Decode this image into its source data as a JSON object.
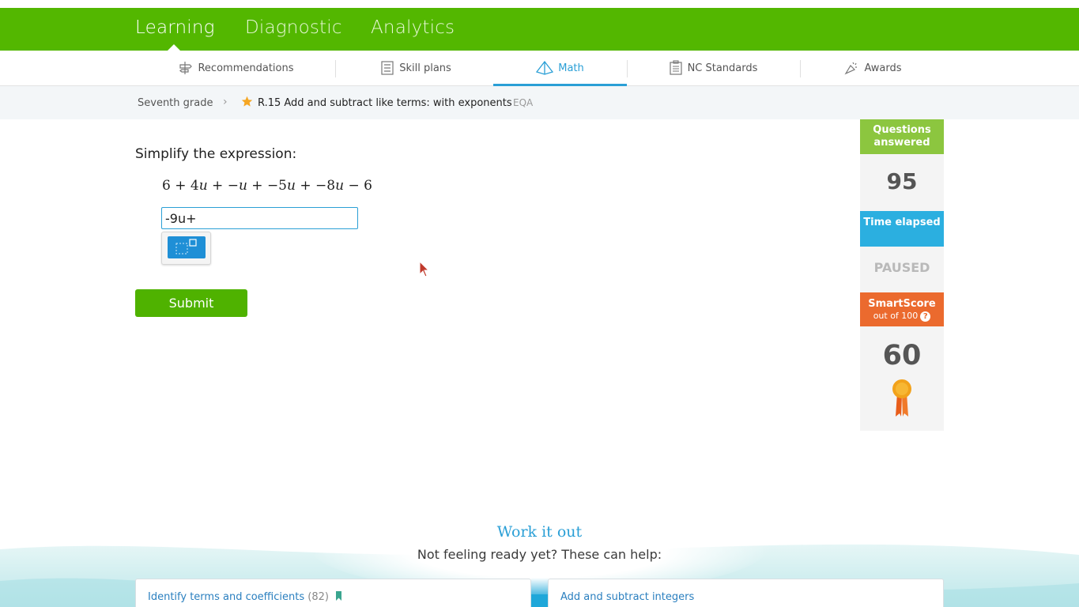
{
  "top_nav": {
    "tabs": [
      {
        "label": "Learning",
        "active": true
      },
      {
        "label": "Diagnostic",
        "active": false
      },
      {
        "label": "Analytics",
        "active": false
      }
    ]
  },
  "sub_nav": {
    "items": [
      {
        "label": "Recommendations",
        "icon": "recommendations-icon",
        "active": false
      },
      {
        "label": "Skill plans",
        "icon": "skill-plans-icon",
        "active": false
      },
      {
        "label": "Math",
        "icon": "math-pyramid-icon",
        "active": true
      },
      {
        "label": "NC Standards",
        "icon": "standards-icon",
        "active": false
      },
      {
        "label": "Awards",
        "icon": "awards-icon",
        "active": false
      }
    ]
  },
  "breadcrumb": {
    "grade": "Seventh grade",
    "skill": "R.15 Add and subtract like terms: with exponents",
    "code": "EQA"
  },
  "question": {
    "prompt": "Simplify the expression:",
    "answer_value": "-9u+",
    "submit_label": "Submit"
  },
  "sidebar": {
    "questions_answered_label": "Questions answered",
    "questions_answered_value": "95",
    "time_elapsed_label": "Time elapsed",
    "time_elapsed_value": "PAUSED",
    "smartscore_label": "SmartScore",
    "smartscore_sub": "out of 100",
    "smartscore_help": "?",
    "smartscore_value": "60"
  },
  "help": {
    "title": "Work it out",
    "subtitle": "Not feeling ready yet? These can help:",
    "cards": [
      {
        "label": "Identify terms and coefficients",
        "count": "(82)",
        "bookmarked": true
      },
      {
        "label": "Add and subtract integers",
        "count": "",
        "bookmarked": false
      }
    ]
  },
  "colors": {
    "brand_green": "#53b700",
    "accent_blue": "#2a9fd6",
    "smartscore_orange": "#eb6a2e"
  }
}
